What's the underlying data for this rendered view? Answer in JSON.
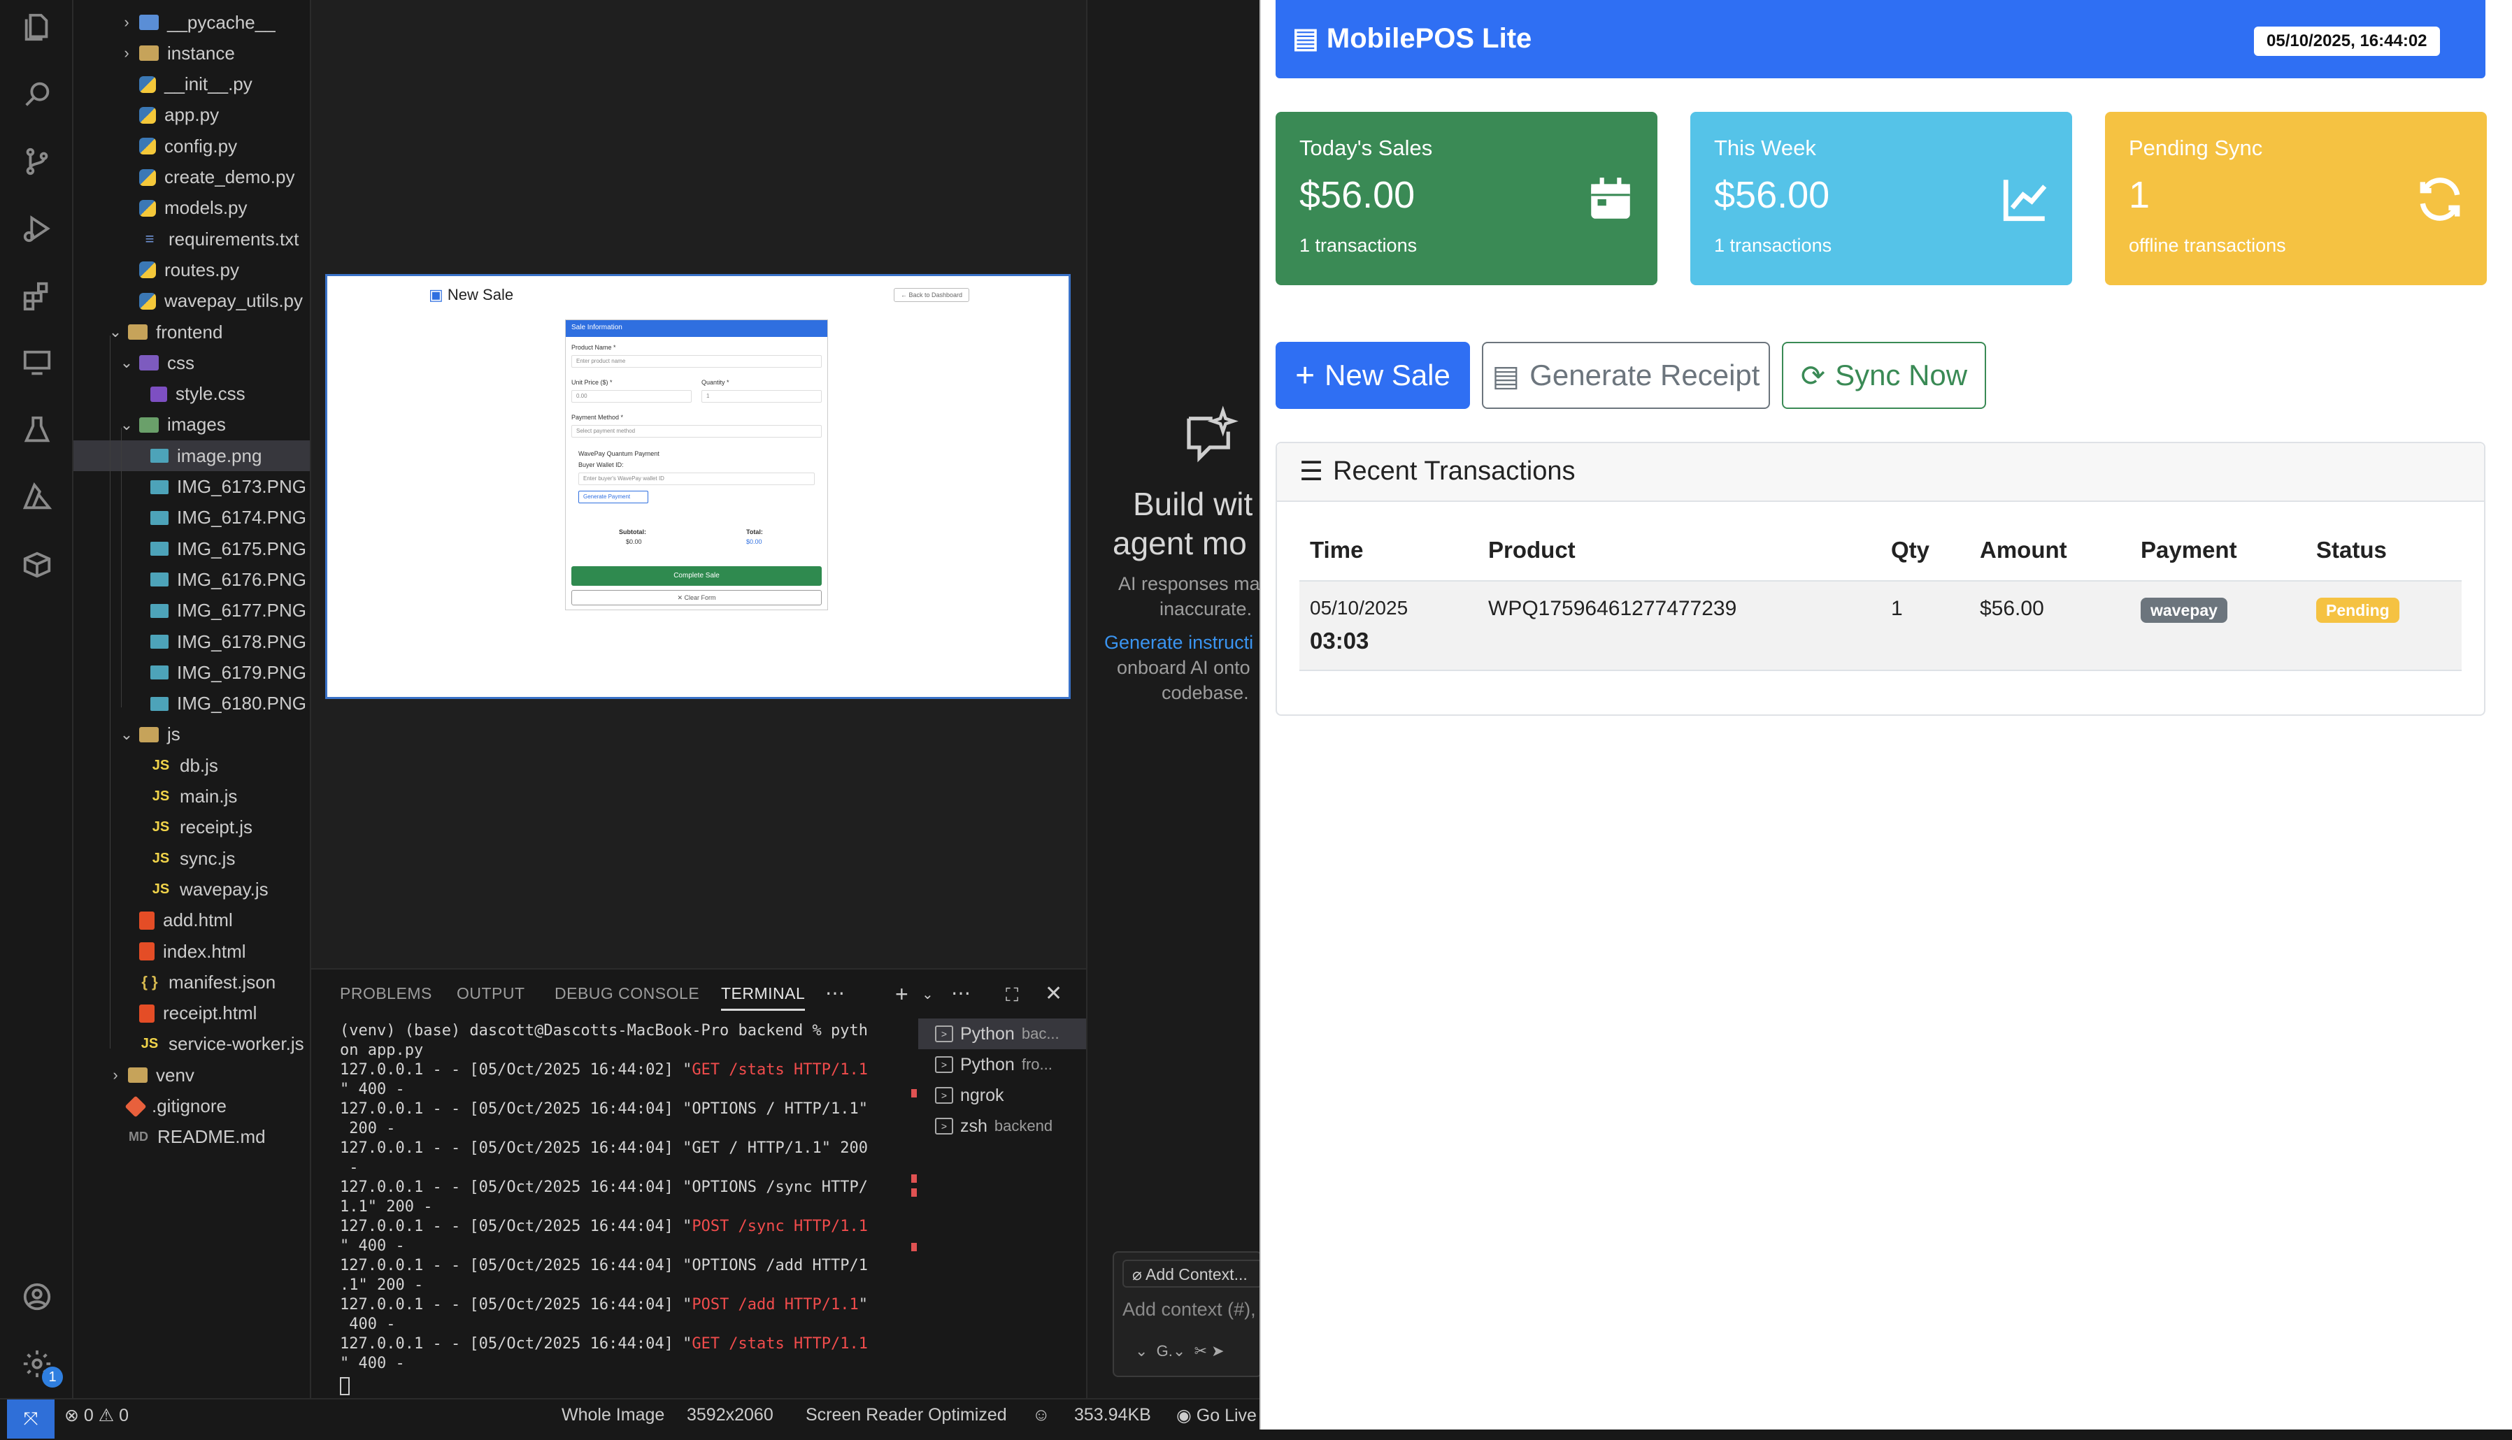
{
  "explorer": {
    "items": [
      {
        "label": "__pycache__",
        "type": "folder"
      },
      {
        "label": "instance",
        "type": "folder"
      },
      {
        "label": "__init__.py",
        "type": "py"
      },
      {
        "label": "app.py",
        "type": "py"
      },
      {
        "label": "config.py",
        "type": "py"
      },
      {
        "label": "create_demo.py",
        "type": "py"
      },
      {
        "label": "models.py",
        "type": "py"
      },
      {
        "label": "requirements.txt",
        "type": "txt"
      },
      {
        "label": "routes.py",
        "type": "py"
      },
      {
        "label": "wavepay_utils.py",
        "type": "py"
      },
      {
        "label": "frontend",
        "type": "folder"
      },
      {
        "label": "css",
        "type": "folder"
      },
      {
        "label": "style.css",
        "type": "css"
      },
      {
        "label": "images",
        "type": "folder"
      },
      {
        "label": "image.png",
        "type": "img"
      },
      {
        "label": "IMG_6173.PNG",
        "type": "img"
      },
      {
        "label": "IMG_6174.PNG",
        "type": "img"
      },
      {
        "label": "IMG_6175.PNG",
        "type": "img"
      },
      {
        "label": "IMG_6176.PNG",
        "type": "img"
      },
      {
        "label": "IMG_6177.PNG",
        "type": "img"
      },
      {
        "label": "IMG_6178.PNG",
        "type": "img"
      },
      {
        "label": "IMG_6179.PNG",
        "type": "img"
      },
      {
        "label": "IMG_6180.PNG",
        "type": "img"
      },
      {
        "label": "js",
        "type": "folder"
      },
      {
        "label": "db.js",
        "type": "js"
      },
      {
        "label": "main.js",
        "type": "js"
      },
      {
        "label": "receipt.js",
        "type": "js"
      },
      {
        "label": "sync.js",
        "type": "js"
      },
      {
        "label": "wavepay.js",
        "type": "js"
      },
      {
        "label": "add.html",
        "type": "html"
      },
      {
        "label": "index.html",
        "type": "html"
      },
      {
        "label": "manifest.json",
        "type": "json"
      },
      {
        "label": "receipt.html",
        "type": "html"
      },
      {
        "label": "service-worker.js",
        "type": "js"
      },
      {
        "label": "venv",
        "type": "folder"
      },
      {
        "label": ".gitignore",
        "type": "git"
      },
      {
        "label": "README.md",
        "type": "md"
      }
    ]
  },
  "preview": {
    "title": "New Sale",
    "back": "← Back to Dashboard",
    "section": "Sale Information",
    "product_label": "Product Name *",
    "product_placeholder": "Enter product name",
    "price_label": "Unit Price ($) *",
    "price_value": "0.00",
    "qty_label": "Quantity *",
    "qty_value": "1",
    "payment_label": "Payment Method *",
    "payment_placeholder": "Select payment method",
    "wavepay_label": "WavePay Quantum Payment",
    "wallet_label": "Buyer Wallet ID:",
    "wallet_placeholder": "Enter buyer's WavePay wallet ID",
    "gen_payment": "Generate Payment",
    "subtotal_label": "Subtotal:",
    "subtotal_value": "$0.00",
    "total_label": "Total:",
    "total_value": "$0.00",
    "complete": "Complete Sale",
    "clear": "✕ Clear Form"
  },
  "agent": {
    "line1": "Build wit",
    "line2": "agent mo",
    "line3": "AI responses ma",
    "line4": "inaccurate.",
    "link": "Generate instructi",
    "line5": "onboard AI onto",
    "line6": "codebase.",
    "add_context": "Add Context...",
    "input_placeholder": "Add context (#),",
    "model": "G."
  },
  "panel": {
    "tabs": [
      "PROBLEMS",
      "OUTPUT",
      "DEBUG CONSOLE",
      "TERMINAL"
    ],
    "terminal_lines": [
      {
        "text": "(venv) (base) dascott@Dascotts-MacBook-Pro backend % pyth",
        "red": ""
      },
      {
        "text": "on app.py",
        "red": ""
      },
      {
        "text": "127.0.0.1 - - [05/Oct/2025 16:44:02] \"",
        "red": "GET /stats HTTP/1.1",
        "tail": ""
      },
      {
        "text": "\" 400 -",
        "red": ""
      },
      {
        "text": "127.0.0.1 - - [05/Oct/2025 16:44:04] \"OPTIONS / HTTP/1.1\"",
        "red": ""
      },
      {
        "text": " 200 -",
        "red": ""
      },
      {
        "text": "127.0.0.1 - - [05/Oct/2025 16:44:04] \"GET / HTTP/1.1\" 200",
        "red": ""
      },
      {
        "text": " -",
        "red": ""
      },
      {
        "text": "127.0.0.1 - - [05/Oct/2025 16:44:04] \"OPTIONS /sync HTTP/",
        "red": ""
      },
      {
        "text": "1.1\" 200 -",
        "red": ""
      },
      {
        "text": "127.0.0.1 - - [05/Oct/2025 16:44:04] \"",
        "red": "POST /sync HTTP/1.1"
      },
      {
        "text": "\" 400 -",
        "red": ""
      },
      {
        "text": "127.0.0.1 - - [05/Oct/2025 16:44:04] \"OPTIONS /add HTTP/1",
        "red": ""
      },
      {
        "text": ".1\" 200 -",
        "red": ""
      },
      {
        "text": "127.0.0.1 - - [05/Oct/2025 16:44:04] \"",
        "red": "POST /add HTTP/1.1",
        "tail": "\""
      },
      {
        "text": " 400 -",
        "red": ""
      },
      {
        "text": "127.0.0.1 - - [05/Oct/2025 16:44:04] \"",
        "red": "GET /stats HTTP/1.1"
      },
      {
        "text": "\" 400 -",
        "red": ""
      }
    ],
    "terminals": [
      {
        "name": "Python",
        "detail": "bac..."
      },
      {
        "name": "Python",
        "detail": "fro..."
      },
      {
        "name": "ngrok",
        "detail": ""
      },
      {
        "name": "zsh",
        "detail": "backend"
      }
    ]
  },
  "statusbar": {
    "problems": "0",
    "warnings": "0",
    "whole_image": "Whole Image",
    "dimensions": "3592x2060",
    "screen_reader": "Screen Reader Optimized",
    "size": "353.94KB",
    "go_live": "Go Live"
  },
  "pos": {
    "brand": "MobilePOS Lite",
    "datetime": "05/10/2025, 16:44:02",
    "stats": [
      {
        "title": "Today's Sales",
        "value": "$56.00",
        "sub": "1 transactions",
        "color": "#3a8a55",
        "icon": "calendar-icon"
      },
      {
        "title": "This Week",
        "value": "$56.00",
        "sub": "1 transactions",
        "color": "#55c3e8",
        "icon": "chart-line-icon"
      },
      {
        "title": "Pending Sync",
        "value": "1",
        "sub": "offline transactions",
        "color": "#f5c242",
        "icon": "sync-icon"
      }
    ],
    "buttons": {
      "new_sale": "New Sale",
      "generate_receipt": "Generate Receipt",
      "sync_now": "Sync Now"
    },
    "recent_title": "Recent Transactions",
    "table": {
      "headers": [
        "Time",
        "Product",
        "Qty",
        "Amount",
        "Payment",
        "Status"
      ],
      "rows": [
        {
          "date": "05/10/2025",
          "time": "03:03",
          "product": "WPQ17596461277477239",
          "qty": "1",
          "amount": "$56.00",
          "payment": "wavepay",
          "status": "Pending"
        }
      ]
    },
    "colors": {
      "primary": "#2f6ff3",
      "success": "#3a8a55",
      "info": "#55c3e8",
      "warning": "#f5c242"
    }
  }
}
